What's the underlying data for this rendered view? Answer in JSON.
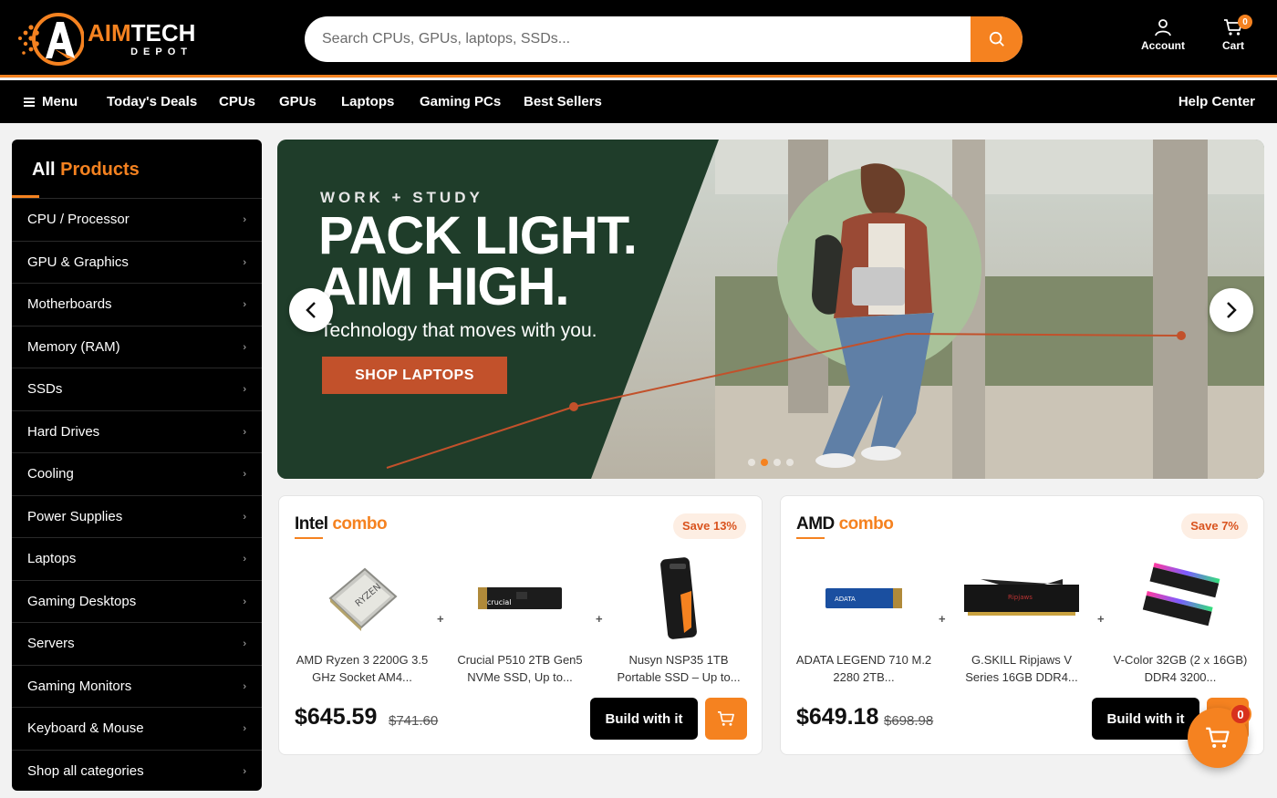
{
  "brand": {
    "name_part1": "AIM",
    "name_part2": "TECH",
    "sub": "DEPOT"
  },
  "search": {
    "placeholder": "Search CPUs, GPUs, laptops, SSDs..."
  },
  "header": {
    "account_label": "Account",
    "cart_label": "Cart",
    "cart_count": "0"
  },
  "nav": {
    "menu_label": "Menu",
    "links": [
      "Today's Deals",
      "CPUs",
      "GPUs",
      "Laptops",
      "Gaming PCs",
      "Best Sellers"
    ],
    "help_label": "Help Center"
  },
  "sidebar": {
    "title_white": "All",
    "title_orange": "Products",
    "items": [
      "CPU / Processor",
      "GPU & Graphics",
      "Motherboards",
      "Memory (RAM)",
      "SSDs",
      "Hard Drives",
      "Cooling",
      "Power Supplies",
      "Laptops",
      "Gaming Desktops",
      "Servers",
      "Gaming Monitors",
      "Keyboard & Mouse",
      "Shop all categories"
    ]
  },
  "hero": {
    "kicker": "WORK + STUDY",
    "headline_line1": "PACK LIGHT.",
    "headline_line2": "AIM HIGH.",
    "subtitle": "Technology that moves with you.",
    "cta": "SHOP LAPTOPS",
    "active_slide": 2,
    "slide_count": 4
  },
  "combos": [
    {
      "brand": "Intel",
      "label": "combo",
      "save": "Save 13%",
      "products": [
        {
          "name": "AMD Ryzen 3 2200G 3.5 GHz Socket AM4...",
          "icon": "cpu-chip"
        },
        {
          "name": "Crucial P510 2TB Gen5 NVMe SSD, Up to...",
          "icon": "m2-ssd"
        },
        {
          "name": "Nusyn NSP35 1TB Portable SSD – Up to...",
          "icon": "portable-ssd"
        }
      ],
      "price": "$645.59",
      "old_price": "$741.60",
      "build_label": "Build with it"
    },
    {
      "brand": "AMD",
      "label": "combo",
      "save": "Save 7%",
      "products": [
        {
          "name": "ADATA LEGEND 710 M.2 2280 2TB...",
          "icon": "m2-ssd"
        },
        {
          "name": "G.SKILL Ripjaws V Series 16GB DDR4...",
          "icon": "ram-stick"
        },
        {
          "name": "V-Color 32GB (2 x 16GB) DDR4 3200...",
          "icon": "rgb-ram"
        }
      ],
      "price": "$649.18",
      "old_price": "$698.98",
      "build_label": "Build with it"
    }
  ],
  "floating_cart": {
    "count": "0"
  },
  "colors": {
    "accent": "#f58220",
    "dark": "#000000",
    "hero_green": "#1f3d2a"
  }
}
